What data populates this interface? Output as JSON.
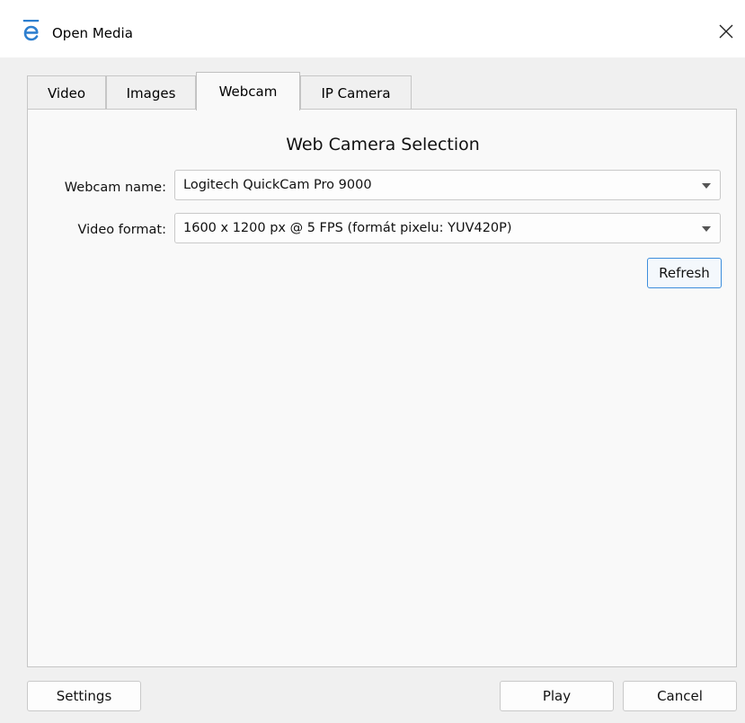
{
  "window": {
    "title": "Open Media"
  },
  "tabs": [
    {
      "label": "Video",
      "active": false
    },
    {
      "label": "Images",
      "active": false
    },
    {
      "label": "Webcam",
      "active": true
    },
    {
      "label": "IP Camera",
      "active": false
    }
  ],
  "webcam": {
    "section_title": "Web Camera Selection",
    "name_label": "Webcam name:",
    "name_value": "Logitech QuickCam Pro 9000",
    "format_label": "Video format:",
    "format_value": "1600 x 1200 px @ 5 FPS (formát pixelu: YUV420P)",
    "refresh_label": "Refresh"
  },
  "footer": {
    "settings_label": "Settings",
    "play_label": "Play",
    "cancel_label": "Cancel"
  },
  "colors": {
    "app_icon": "#2e7fcf",
    "focus_border": "#3d8edc"
  },
  "icons": {
    "app": "e-logo-icon",
    "close": "close-icon",
    "dropdown": "chevron-down-icon"
  }
}
